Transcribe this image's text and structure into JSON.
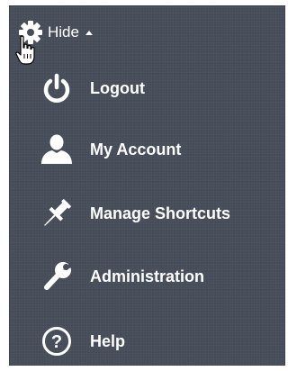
{
  "settings_toggle": {
    "label": "Hide",
    "icon": "gear-icon",
    "arrow_icon": "caret-up-icon"
  },
  "menu": {
    "items": [
      {
        "label": "Logout",
        "icon": "power-icon"
      },
      {
        "label": "My Account",
        "icon": "user-icon"
      },
      {
        "label": "Manage Shortcuts",
        "icon": "pin-icon"
      },
      {
        "label": "Administration",
        "icon": "wrench-icon"
      },
      {
        "label": "Help",
        "icon": "question-circle-icon"
      }
    ]
  },
  "colors": {
    "panel_background": "#474c59",
    "text": "#ffffff"
  }
}
